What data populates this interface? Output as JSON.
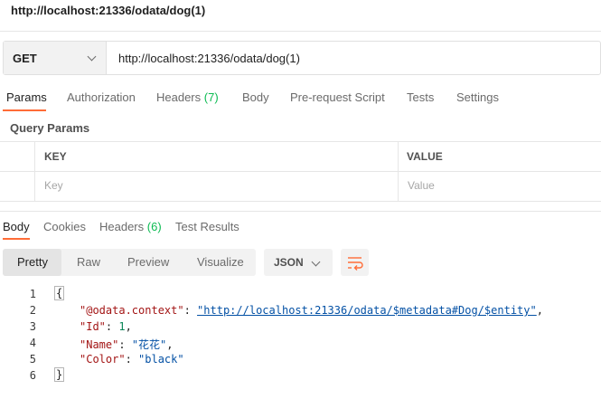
{
  "window": {
    "title": "http://localhost:21336/odata/dog(1)"
  },
  "request": {
    "method": "GET",
    "url": "http://localhost:21336/odata/dog(1)",
    "tabs": [
      {
        "label": "Params",
        "active": true
      },
      {
        "label": "Authorization"
      },
      {
        "label": "Headers",
        "count": "(7)"
      },
      {
        "label": "Body"
      },
      {
        "label": "Pre-request Script"
      },
      {
        "label": "Tests"
      },
      {
        "label": "Settings"
      }
    ],
    "query_params": {
      "title": "Query Params",
      "key_header": "KEY",
      "value_header": "VALUE",
      "key_placeholder": "Key",
      "value_placeholder": "Value"
    }
  },
  "response": {
    "tabs": [
      {
        "label": "Body",
        "active": true
      },
      {
        "label": "Cookies"
      },
      {
        "label": "Headers",
        "count": "(6)"
      },
      {
        "label": "Test Results"
      }
    ],
    "view_modes": [
      "Pretty",
      "Raw",
      "Preview",
      "Visualize"
    ],
    "format": "JSON",
    "lines": [
      {
        "n": "1",
        "text": "{"
      },
      {
        "n": "2",
        "key": "\"@odata.context\"",
        "value": "\"http://localhost:21336/odata/$metadata#Dog/$entity\""
      },
      {
        "n": "3",
        "key": "\"Id\"",
        "value": "1"
      },
      {
        "n": "4",
        "key": "\"Name\"",
        "value": "\"花花\""
      },
      {
        "n": "5",
        "key": "\"Color\"",
        "value": "\"black\""
      },
      {
        "n": "6",
        "text": "}"
      }
    ]
  },
  "colors": {
    "accent": "#ff6c37",
    "count_green": "#0cbb52",
    "json_key": "#a31515",
    "json_string": "#0451a5",
    "json_number": "#098658"
  },
  "icons": {
    "method_dropdown": "chevron-down-icon",
    "format_dropdown": "chevron-down-icon",
    "wrap": "wrap-lines-icon"
  }
}
